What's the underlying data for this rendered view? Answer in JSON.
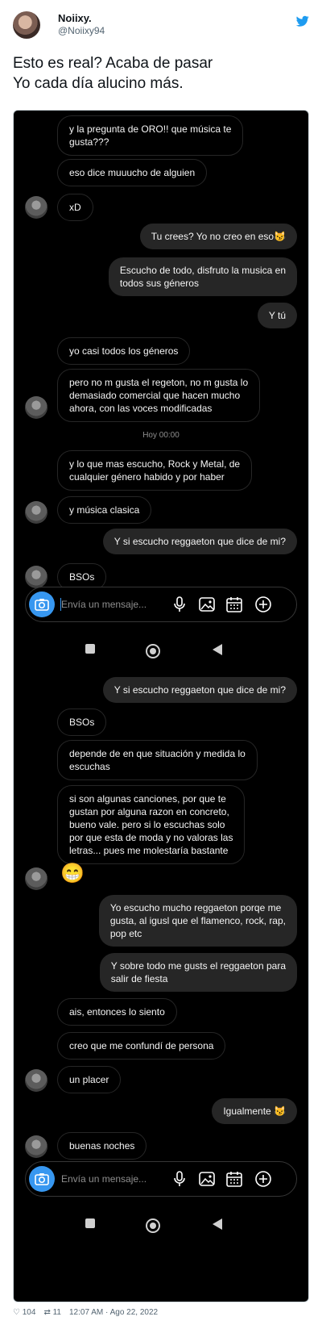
{
  "tweet": {
    "name": "Noiixy.",
    "handle": "@Noiixy94",
    "text_line1": "Esto es real? Acaba de pasar",
    "text_line2": "Yo cada día alucino más.",
    "likes": "104",
    "retweets": "11",
    "time": "12:07 AM · Ago 22, 2022"
  },
  "dm": {
    "composer_placeholder": "Envía un mensaje...",
    "timestamp": "Hoy 00:00",
    "screen1": [
      {
        "dir": "in",
        "text": "y la pregunta de ORO!! que música te\ngusta???"
      },
      {
        "dir": "in",
        "text": "eso dice muuucho de alguien"
      },
      {
        "dir": "in",
        "text": "xD"
      },
      {
        "dir": "out",
        "text": "Tu crees? Yo no creo en eso😼"
      },
      {
        "dir": "out",
        "text": "Escucho de todo, disfruto la musica en\ntodos sus géneros"
      },
      {
        "dir": "out",
        "text": "Y tú"
      },
      {
        "dir": "in",
        "text": "yo casi todos los géneros"
      },
      {
        "dir": "in",
        "text": "pero no m gusta el regeton, no m gusta lo\ndemasiado comercial que hacen mucho\nahora, con las voces modificadas"
      },
      {
        "dir": "in",
        "text": "y lo que mas escucho, Rock y Metal, de\ncualquier género habido y por haber"
      },
      {
        "dir": "in",
        "text": "y música clasica"
      },
      {
        "dir": "out",
        "text": "Y si escucho reggaeton que dice de mi?"
      },
      {
        "dir": "in",
        "text": "BSOs"
      }
    ],
    "screen2": [
      {
        "dir": "out",
        "text": "Y si escucho reggaeton que dice de mi?"
      },
      {
        "dir": "in",
        "text": "BSOs"
      },
      {
        "dir": "in",
        "text": "depende de en que situación y medida lo\nescuchas"
      },
      {
        "dir": "in",
        "text": "si son algunas canciones, por que te\ngustan por alguna razon en concreto,\nbueno vale. pero si lo escuchas solo\npor que esta de moda y no valoras las\nletras... pues me molestaría bastante"
      },
      {
        "dir": "in",
        "text": "😁"
      },
      {
        "dir": "out",
        "text": "Yo escucho mucho reggaeton porqe me\ngusta, al igusl que el flamenco, rock, rap,\npop etc"
      },
      {
        "dir": "out",
        "text": "Y sobre todo me gusts el reggaeton para\nsalir de fiesta"
      },
      {
        "dir": "in",
        "text": "ais, entonces lo siento"
      },
      {
        "dir": "in",
        "text": "creo que me confundí de persona"
      },
      {
        "dir": "in",
        "text": "un placer"
      },
      {
        "dir": "out",
        "text": "Igualmente 😼"
      },
      {
        "dir": "in",
        "text": "buenas noches"
      }
    ]
  },
  "colors": {
    "dm_background": "#000000",
    "outgoing_bubble": "#262626",
    "camera_button": "#3797f0",
    "twitter_blue": "#1d9bf0"
  }
}
